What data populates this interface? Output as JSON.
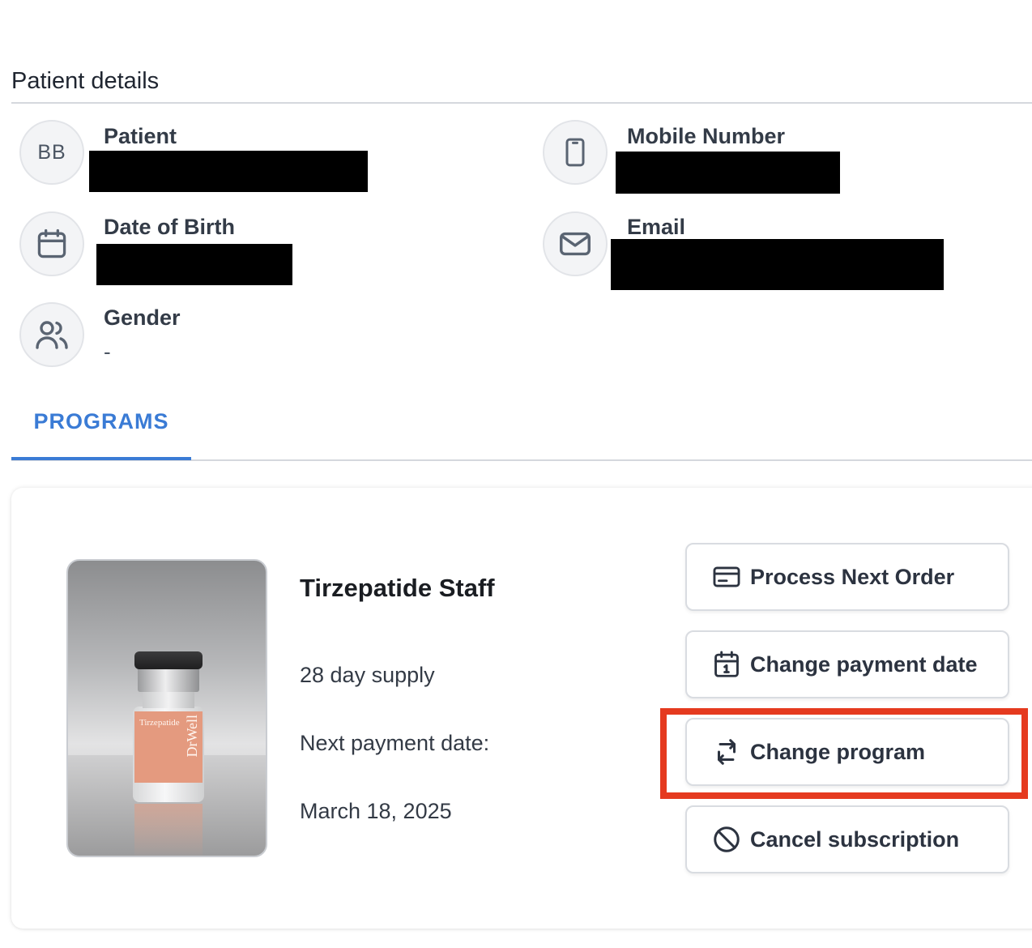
{
  "header": {
    "title": "Patient details"
  },
  "details": {
    "patient": {
      "label": "Patient",
      "avatar_initials": "BB",
      "icon": "avatar-initials"
    },
    "mobile": {
      "label": "Mobile Number",
      "icon": "phone-icon"
    },
    "dob": {
      "label": "Date of Birth",
      "icon": "calendar-icon"
    },
    "email": {
      "label": "Email",
      "icon": "mail-icon"
    },
    "gender": {
      "label": "Gender",
      "value": "-",
      "icon": "users-icon"
    }
  },
  "tabs": [
    {
      "label": "PROGRAMS",
      "active": true
    }
  ],
  "program": {
    "name": "Tirzepatide Staff",
    "supply": "28 day supply",
    "next_payment_label": "Next payment date:",
    "next_payment_date": "March 18, 2025",
    "image": {
      "label_title": "Tirzepatide",
      "brand": "DrWell"
    }
  },
  "actions": [
    {
      "label": "Process Next Order",
      "icon": "credit-card-icon"
    },
    {
      "label": "Change payment date",
      "icon": "calendar-date-icon"
    },
    {
      "label": "Change program",
      "icon": "repeat-icon",
      "highlighted": true
    },
    {
      "label": "Cancel subscription",
      "icon": "ban-icon"
    }
  ],
  "colors": {
    "accent": "#3a7bd5",
    "highlight": "#e53a1f",
    "product_label": "#e49a7f"
  }
}
